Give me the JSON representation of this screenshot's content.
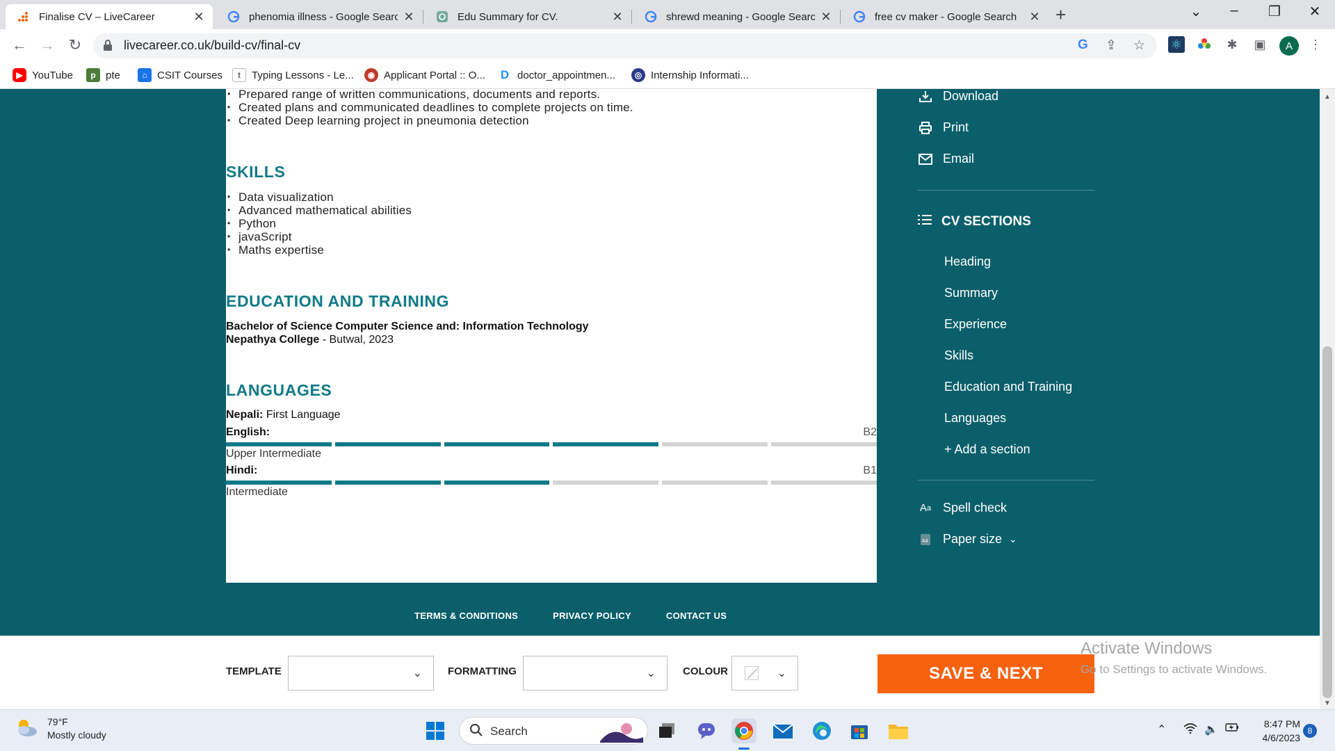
{
  "browser": {
    "tabs": [
      {
        "title": "Finalise CV – LiveCareer",
        "icon": "livecareer-icon",
        "active": true
      },
      {
        "title": "phenomia illness - Google Search",
        "icon": "google-icon",
        "active": false
      },
      {
        "title": "Edu Summary for CV.",
        "icon": "chatgpt-icon",
        "active": false
      },
      {
        "title": "shrewd meaning - Google Search",
        "icon": "google-icon",
        "active": false
      },
      {
        "title": "free cv maker - Google Search",
        "icon": "google-icon",
        "active": false
      }
    ],
    "url": "livecareer.co.uk/build-cv/final-cv",
    "profile_initial": "A",
    "bookmarks": [
      {
        "label": "YouTube",
        "icon": "youtube-icon",
        "color": "#ff0000"
      },
      {
        "label": "pte",
        "icon": "pte-icon",
        "color": "#4b7d3a"
      },
      {
        "label": "CSIT Courses",
        "icon": "csit-icon",
        "color": "#1a73e8"
      },
      {
        "label": "Typing Lessons - Le...",
        "icon": "typing-icon",
        "color": "#5f6368"
      },
      {
        "label": "Applicant Portal :: O...",
        "icon": "portal-icon",
        "color": "#c0392b"
      },
      {
        "label": "doctor_appointmen...",
        "icon": "d-icon",
        "color": "#1e90ff"
      },
      {
        "label": "Internship Informati...",
        "icon": "globe-icon",
        "color": "#2b3a8c"
      }
    ]
  },
  "cv": {
    "experience_bullets": [
      "Prepared range of written communications, documents and reports.",
      "Created plans and communicated deadlines to complete projects on time.",
      "Created Deep learning project in pneumonia detection"
    ],
    "skills_heading": "SKILLS",
    "skills": [
      "Data visualization",
      "Advanced mathematical abilities",
      "Python",
      "javaScript",
      "Maths expertise"
    ],
    "education_heading": "EDUCATION AND TRAINING",
    "education": {
      "degree": "Bachelor of Science Computer Science and: Information Technology",
      "school": "Nepathya College",
      "location": " - Butwal, 2023"
    },
    "languages_heading": "LANGUAGES",
    "native": {
      "name": "Nepali:",
      "level": "First Language"
    },
    "languages": [
      {
        "name": "English:",
        "code": "B2",
        "description": "Upper Intermediate",
        "filled": 4,
        "total": 6
      },
      {
        "name": "Hindi:",
        "code": "B1",
        "description": "Intermediate",
        "filled": 3,
        "total": 6
      }
    ]
  },
  "rail": {
    "actions": [
      {
        "label": "Download",
        "icon": "download-icon"
      },
      {
        "label": "Print",
        "icon": "print-icon"
      },
      {
        "label": "Email",
        "icon": "email-icon"
      }
    ],
    "sections_heading": "CV SECTIONS",
    "sections": [
      "Heading",
      "Summary",
      "Experience",
      "Skills",
      "Education and Training",
      "Languages"
    ],
    "add_section": "+ Add a section",
    "spell_check": "Spell check",
    "paper_size": "Paper size"
  },
  "footer": {
    "links": [
      "TERMS & CONDITIONS",
      "PRIVACY POLICY",
      "CONTACT US"
    ]
  },
  "actionbar": {
    "template_label": "TEMPLATE",
    "formatting_label": "FORMATTING",
    "colour_label": "COLOUR",
    "save_label": "SAVE & NEXT"
  },
  "watermark": {
    "line1": "Activate Windows",
    "line2": "Go to Settings to activate Windows."
  },
  "taskbar": {
    "temperature": "79°F",
    "weather": "Mostly cloudy",
    "search_placeholder": "Search",
    "time": "8:47 PM",
    "date": "4/6/2023",
    "notifications": "8"
  },
  "colors": {
    "page_bg": "#0b5f6b",
    "accent": "#107a87",
    "save": "#f7620e"
  }
}
